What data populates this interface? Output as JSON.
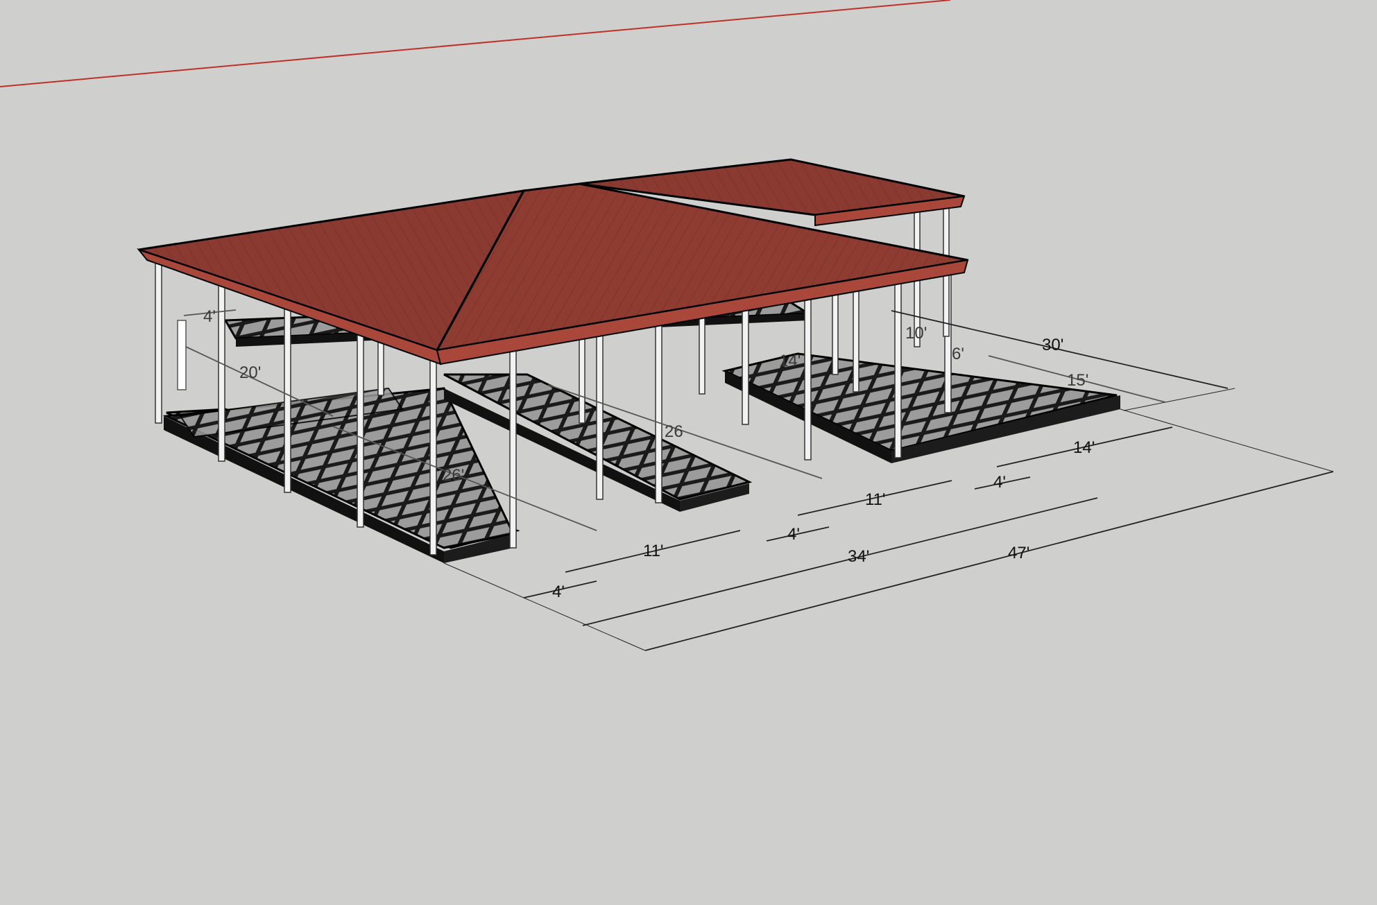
{
  "scene": {
    "background": "#cfcfcd",
    "roof_color": "#8a3a30",
    "roof_fascia_color": "#a8473a",
    "dock_frame_color": "#111111",
    "dock_panel_color": "#9a9a9a",
    "axis_color": "#c0302a",
    "icons": [
      "3d-boat-dock-model",
      "red-axis-line"
    ]
  },
  "dimensions": {
    "d_4ft_left_back": "4'",
    "d_20ft": "20'",
    "d_26ft_left": "26'",
    "d_26ft_mid": "26",
    "d_14ft_top": "14'",
    "d_10ft": "10'",
    "d_6ft": "6'",
    "d_15ft": "15'",
    "d_30ft": "30'",
    "d_14ft_right": "14'",
    "d_11ft_right": "11'",
    "d_4ft_right": "4'",
    "d_11ft_mid": "11'",
    "d_4ft_mid": "4'",
    "d_4ft_front": "4'",
    "d_34ft": "34'",
    "d_47ft": "47'"
  }
}
